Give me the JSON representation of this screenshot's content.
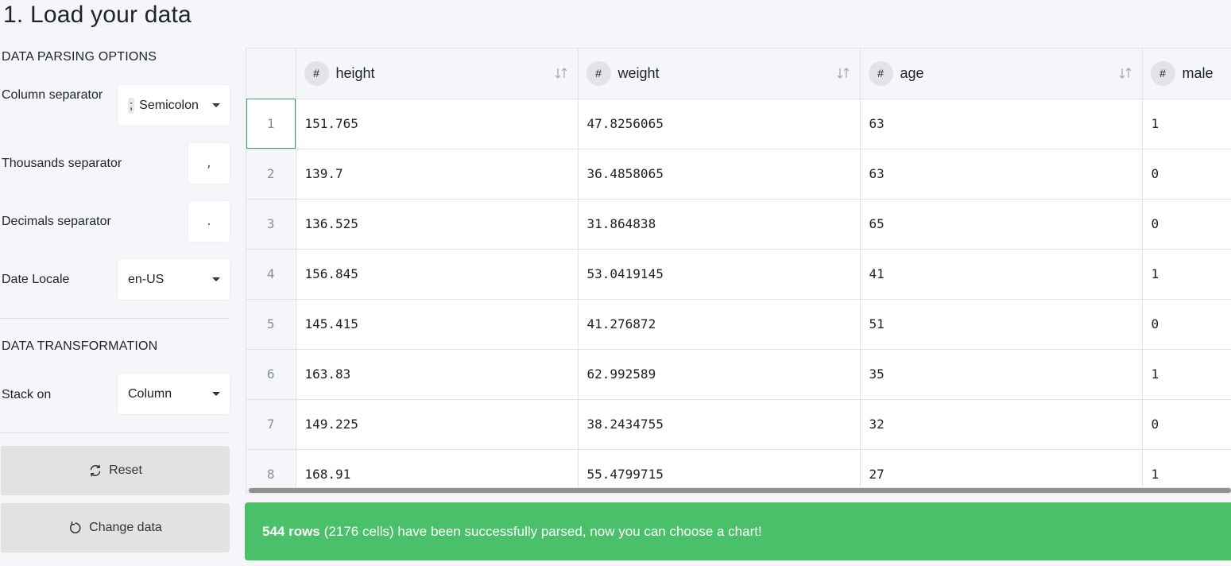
{
  "page": {
    "title": "1. Load your data"
  },
  "parsing": {
    "heading": "DATA PARSING OPTIONS",
    "column_separator": {
      "label": "Column separator",
      "glyph": ";",
      "value": "Semicolon"
    },
    "thousands_separator": {
      "label": "Thousands separator",
      "value": ","
    },
    "decimals_separator": {
      "label": "Decimals separator",
      "value": "."
    },
    "date_locale": {
      "label": "Date Locale",
      "value": "en-US"
    }
  },
  "transformation": {
    "heading": "DATA TRANSFORMATION",
    "stack_on": {
      "label": "Stack on",
      "value": "Column"
    }
  },
  "buttons": {
    "reset": "Reset",
    "change_data": "Change data"
  },
  "table": {
    "columns": [
      {
        "type": "#",
        "name": "height"
      },
      {
        "type": "#",
        "name": "weight"
      },
      {
        "type": "#",
        "name": "age"
      },
      {
        "type": "#",
        "name": "male"
      }
    ],
    "rows": [
      {
        "index": "1",
        "cells": [
          "151.765",
          "47.8256065",
          "63",
          "1"
        ]
      },
      {
        "index": "2",
        "cells": [
          "139.7",
          "36.4858065",
          "63",
          "0"
        ]
      },
      {
        "index": "3",
        "cells": [
          "136.525",
          "31.864838",
          "65",
          "0"
        ]
      },
      {
        "index": "4",
        "cells": [
          "156.845",
          "53.0419145",
          "41",
          "1"
        ]
      },
      {
        "index": "5",
        "cells": [
          "145.415",
          "41.276872",
          "51",
          "0"
        ]
      },
      {
        "index": "6",
        "cells": [
          "163.83",
          "62.992589",
          "35",
          "1"
        ]
      },
      {
        "index": "7",
        "cells": [
          "149.225",
          "38.2434755",
          "32",
          "0"
        ]
      },
      {
        "index": "8",
        "cells": [
          "168.91",
          "55.4799715",
          "27",
          "1"
        ]
      }
    ]
  },
  "status": {
    "rows_count": "544 rows",
    "message": "(2176 cells) have been successfully parsed, now you can choose a chart!"
  },
  "colors": {
    "success": "#4ac06a",
    "selection": "#3aa35c"
  }
}
